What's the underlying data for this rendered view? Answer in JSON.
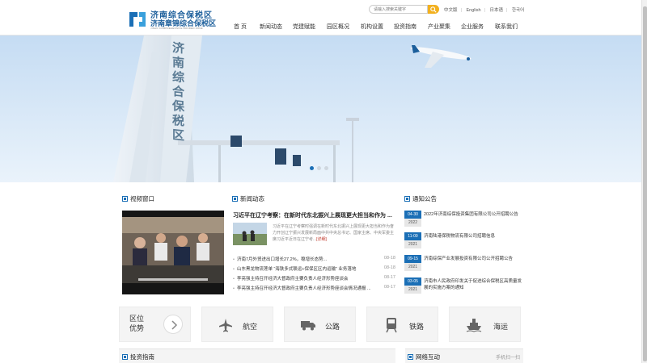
{
  "logo": {
    "line1": "济南综合保税区",
    "line2": "济南章锦综合保税区",
    "line3": "JINAN COMPREHENSIVE BONDED ZONE"
  },
  "search": {
    "placeholder": "请输入搜索关键字"
  },
  "langs": [
    "中文版",
    "English",
    "日本语",
    "한국어"
  ],
  "nav": [
    "首 页",
    "新闻动态",
    "党建赋能",
    "园区概况",
    "机构设置",
    "投资指南",
    "产业聚集",
    "企业服务",
    "联系我们"
  ],
  "banner": {
    "sign_text": "济南综合保税区"
  },
  "video": {
    "title": "视频窗口"
  },
  "news": {
    "title": "新闻动态",
    "headline": "习近平在辽宁考察：在新时代东北振兴上展现更大担当和作为 ...",
    "summary": "习近平在辽宁考察时强调在新时代东北振兴上展现更大担当和作为奋力开创辽宁振兴发展新局面中共中央总书记、国家主席、中央军委主席习近平近日在辽宁考...",
    "more": "[详细]",
    "items": [
      {
        "title": "济南7月外贸进出口增长27.2%，稳增长态势...",
        "date": "08-18"
      },
      {
        "title": "山东黑龙物流莲单 “海铁多式联运+保保区区内运输” 业务落地",
        "date": "08-18"
      },
      {
        "title": "李亮强主持召开经济大督政府主要负责人经济形势座谈会",
        "date": "08-17"
      },
      {
        "title": "李亮强主持召开经济大督政府主要负责人经济形势座谈会情况通报 ...",
        "date": "08-17"
      }
    ]
  },
  "notice": {
    "title": "通知公告",
    "items": [
      {
        "md": "04-30",
        "yr": "2022",
        "text": "2022年济南综保投资集团有限公司公开招聘公告"
      },
      {
        "md": "11-09",
        "yr": "2021",
        "text": "济南陆港保税物流有限公司招聘信息"
      },
      {
        "md": "09-15",
        "yr": "2021",
        "text": "济南综保产业发展投资有限公司公开招聘公告"
      },
      {
        "md": "03-05",
        "yr": "2021",
        "text": "济南市人民政府印发关于促进综合保税区高质量发展的实施方案的通知"
      }
    ]
  },
  "services": {
    "first": {
      "line1": "区位",
      "line2": "优势"
    },
    "items": [
      {
        "label": "航空",
        "icon": "airplane-icon"
      },
      {
        "label": "公路",
        "icon": "truck-icon"
      },
      {
        "label": "铁路",
        "icon": "train-icon"
      },
      {
        "label": "海运",
        "icon": "ship-icon"
      }
    ]
  },
  "bottom": {
    "invest_title": "投资指南",
    "interact_title": "网络互动",
    "interact_right": "手机扫一扫"
  },
  "colors": {
    "brand": "#1b6fb6",
    "accent": "#f2b01e"
  }
}
